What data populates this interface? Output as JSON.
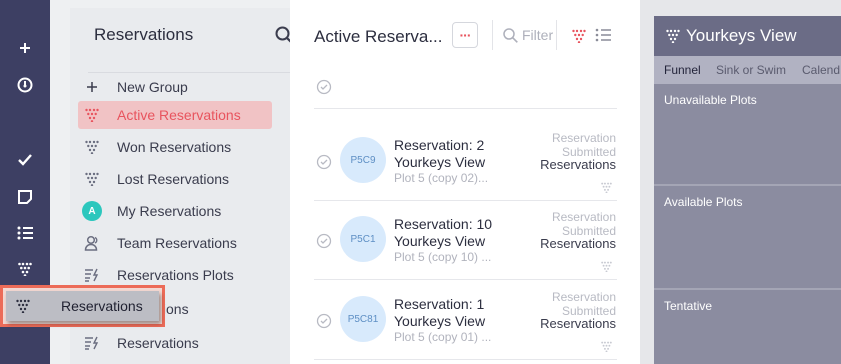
{
  "rail": {
    "icons": [
      "plus-icon",
      "speedometer-icon",
      "checkmark-icon",
      "note-icon",
      "list-icon",
      "funnel-icon"
    ]
  },
  "left_panel": {
    "title": "Reservations",
    "nav": [
      {
        "label": "New Group",
        "icon": "plus-icon"
      },
      {
        "label": "Active Reservations",
        "icon": "funnel-icon",
        "active": true
      },
      {
        "label": "Won Reservations",
        "icon": "funnel-icon"
      },
      {
        "label": "Lost Reservations",
        "icon": "funnel-icon"
      },
      {
        "label": "My Reservations",
        "icon": "avatar-icon",
        "avatar_letter": "A"
      },
      {
        "label": "Team Reservations",
        "icon": "team-icon"
      },
      {
        "label": "Reservations Plots",
        "icon": "smart-list-icon"
      },
      {
        "label": "eservations",
        "icon": "smart-list-icon"
      },
      {
        "label": "Reservations",
        "icon": "smart-list-icon"
      }
    ],
    "drag_item": {
      "label": "Reservations",
      "icon": "funnel-icon"
    }
  },
  "middle": {
    "title": "Active Reserva...",
    "filter_placeholder": "Filter",
    "cards": [
      {
        "badge": "P5C9",
        "line1": "Reservation: 2",
        "line2": "Yourkeys View",
        "line3": "Plot 5 (copy 02)...",
        "stage1": "Reservation",
        "stage2": "Submitted",
        "type": "Reservations"
      },
      {
        "badge": "P5C1",
        "line1": "Reservation: 10",
        "line2": "Yourkeys View",
        "line3": "Plot 5 (copy 10) ...",
        "stage1": "Reservation",
        "stage2": "Submitted",
        "type": "Reservations"
      },
      {
        "badge": "P5C81",
        "line1": "Reservation: 1",
        "line2": "Yourkeys View",
        "line3": "Plot 5 (copy 01) ...",
        "stage1": "Reservation",
        "stage2": "Submitted",
        "type": "Reservations"
      }
    ]
  },
  "right_panel": {
    "title": "Yourkeys View",
    "tabs": [
      "Funnel",
      "Sink or Swim",
      "Calend"
    ],
    "columns": [
      "Unavailable Plots",
      "Available Plots",
      "Tentative"
    ]
  },
  "colors": {
    "rail": "#3d3f63",
    "accent": "#e8545e",
    "active_bg": "#f1c3c5",
    "avatar": "#2cc7bd",
    "badge_bg": "#d8eafc",
    "drag_border": "#ec6b58",
    "right_header": "#6b6c86"
  }
}
